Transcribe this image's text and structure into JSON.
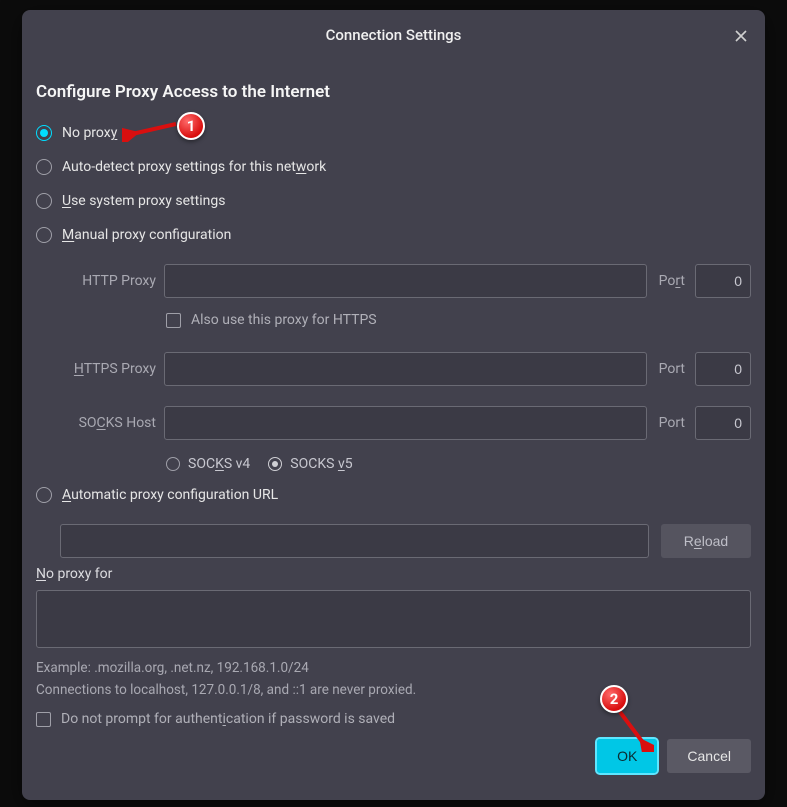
{
  "dialog": {
    "title": "Connection Settings",
    "heading": "Configure Proxy Access to the Internet"
  },
  "radios": {
    "no_proxy": {
      "label_plain": "No prox",
      "label_ul": "y"
    },
    "auto_detect": {
      "pre": "Auto-detect proxy settings for this net",
      "ul": "w",
      "post": "ork"
    },
    "system": {
      "ul": "U",
      "post": "se system proxy settings"
    },
    "manual": {
      "ul": "M",
      "post": "anual proxy configuration"
    },
    "pac": {
      "ul": "A",
      "post": "utomatic proxy configuration URL"
    }
  },
  "manual": {
    "http_label": "HTTP Proxy",
    "https_label_pre": "",
    "https_label_ul": "H",
    "https_label_post": "TTPS Proxy",
    "socks_label_pre": "SO",
    "socks_label_ul": "C",
    "socks_label_post": "KS Host",
    "port_label_pre": "Po",
    "port_label_ul": "r",
    "port_label_post": "t",
    "port_label2": "Port",
    "http_value": "",
    "http_port": "0",
    "https_value": "",
    "https_port": "0",
    "socks_value": "",
    "socks_port": "0",
    "also_https_label": "Also use this proxy for HTTPS",
    "socks_v4_pre": "SOC",
    "socks_v4_ul": "K",
    "socks_v4_post": "S v4",
    "socks_v5_pre": "SOCKS ",
    "socks_v5_ul": "v",
    "socks_v5_post": "5"
  },
  "pac": {
    "url": "",
    "reload_pre": "R",
    "reload_ul": "e",
    "reload_post": "load"
  },
  "noproxy": {
    "label_ul": "N",
    "label_post": "o proxy for",
    "value": "",
    "example": "Example: .mozilla.org, .net.nz, 192.168.1.0/24",
    "note": "Connections to localhost, 127.0.0.1/8, and ::1 are never proxied."
  },
  "auth_check": {
    "pre": "Do not prompt for authent",
    "ul": "i",
    "post": "cation if password is saved"
  },
  "buttons": {
    "ok": "OK",
    "cancel": "Cancel"
  },
  "annotations": {
    "badge1": "1",
    "badge2": "2"
  }
}
